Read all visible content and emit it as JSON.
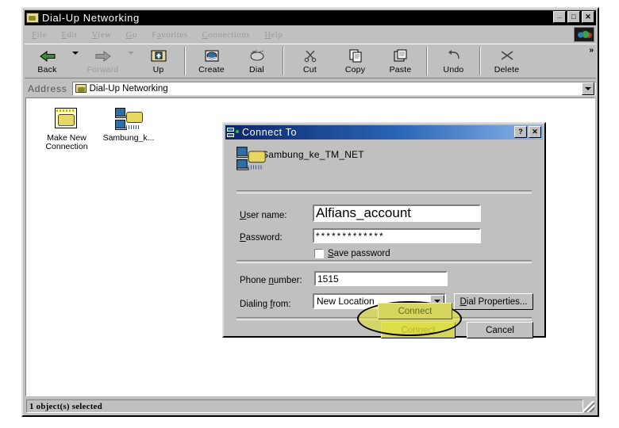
{
  "window": {
    "title": "Dial-Up Networking",
    "title_icon": "dialup-folder-icon",
    "buttons": {
      "minimize": "_",
      "maximize": "□",
      "close": "✕"
    }
  },
  "menu": {
    "items": [
      {
        "label": "File",
        "accel": "F"
      },
      {
        "label": "Edit",
        "accel": "E"
      },
      {
        "label": "View",
        "accel": "V"
      },
      {
        "label": "Go",
        "accel": "G"
      },
      {
        "label": "Favorites",
        "accel": "a"
      },
      {
        "label": "Connections",
        "accel": "C"
      },
      {
        "label": "Help",
        "accel": "H"
      }
    ]
  },
  "toolbar": {
    "buttons": [
      {
        "label": "Back",
        "icon": "back-arrow-icon",
        "disabled": false,
        "dropdown": true
      },
      {
        "label": "Forward",
        "icon": "forward-arrow-icon",
        "disabled": true,
        "dropdown": true
      },
      {
        "label": "Up",
        "icon": "up-folder-icon",
        "disabled": false,
        "dropdown": false
      },
      {
        "label": "Create",
        "icon": "create-icon",
        "disabled": false,
        "dropdown": false
      },
      {
        "label": "Dial",
        "icon": "dial-icon",
        "disabled": false,
        "dropdown": false
      },
      {
        "label": "Cut",
        "icon": "scissors-icon",
        "disabled": false,
        "dropdown": false
      },
      {
        "label": "Copy",
        "icon": "copy-icon",
        "disabled": false,
        "dropdown": false
      },
      {
        "label": "Paste",
        "icon": "paste-icon",
        "disabled": false,
        "dropdown": false
      },
      {
        "label": "Undo",
        "icon": "undo-icon",
        "disabled": false,
        "dropdown": false
      },
      {
        "label": "Delete",
        "icon": "delete-x-icon",
        "disabled": false,
        "dropdown": false
      }
    ],
    "overflow_label": "»"
  },
  "address": {
    "label": "Address",
    "value": "Dial-Up Networking",
    "icon": "dialup-folder-icon"
  },
  "content": {
    "icons": [
      {
        "label": "Make New Connection",
        "icon": "make-new-connection-icon"
      },
      {
        "label": "Sambung_k...",
        "icon": "dialup-connection-icon"
      }
    ]
  },
  "status": {
    "text": "1 object(s) selected"
  },
  "dialog": {
    "title": "Connect To",
    "title_icon": "connect-to-icon",
    "buttons": {
      "help": "?",
      "close": "✕"
    },
    "connection_name": "Sambung_ke_TM_NET",
    "connection_icon": "dialup-connection-icon",
    "fields": {
      "username_label": "User name:",
      "username_accel": "U",
      "username_value": "Alfians_account",
      "password_label": "Password:",
      "password_accel": "P",
      "password_value": "*************",
      "save_password_label": "Save password",
      "save_password_accel": "S",
      "save_password_checked": false,
      "phone_label": "Phone number:",
      "phone_accel": "n",
      "phone_value": "1515",
      "dialing_from_label": "Dialing from:",
      "dialing_from_accel": "f",
      "dialing_from_value": "New Location",
      "dial_properties_label": "Dial Properties...",
      "dial_properties_accel": "D"
    },
    "actions": {
      "connect_label": "Connect",
      "cancel_label": "Cancel"
    }
  },
  "annotation": {
    "type": "highlight-ellipse",
    "target": "connect-button",
    "fill_color": "#e2e23c",
    "outline_color": "#000000"
  },
  "colors": {
    "window_face": "#c0c0c0",
    "titlebar_active": "#0a246a",
    "titlebar_gradient_end": "#8ab4e8",
    "window_titlebar": "#000000",
    "field_bg": "#ffffff",
    "highlight_yellow": "#d6d65e"
  }
}
